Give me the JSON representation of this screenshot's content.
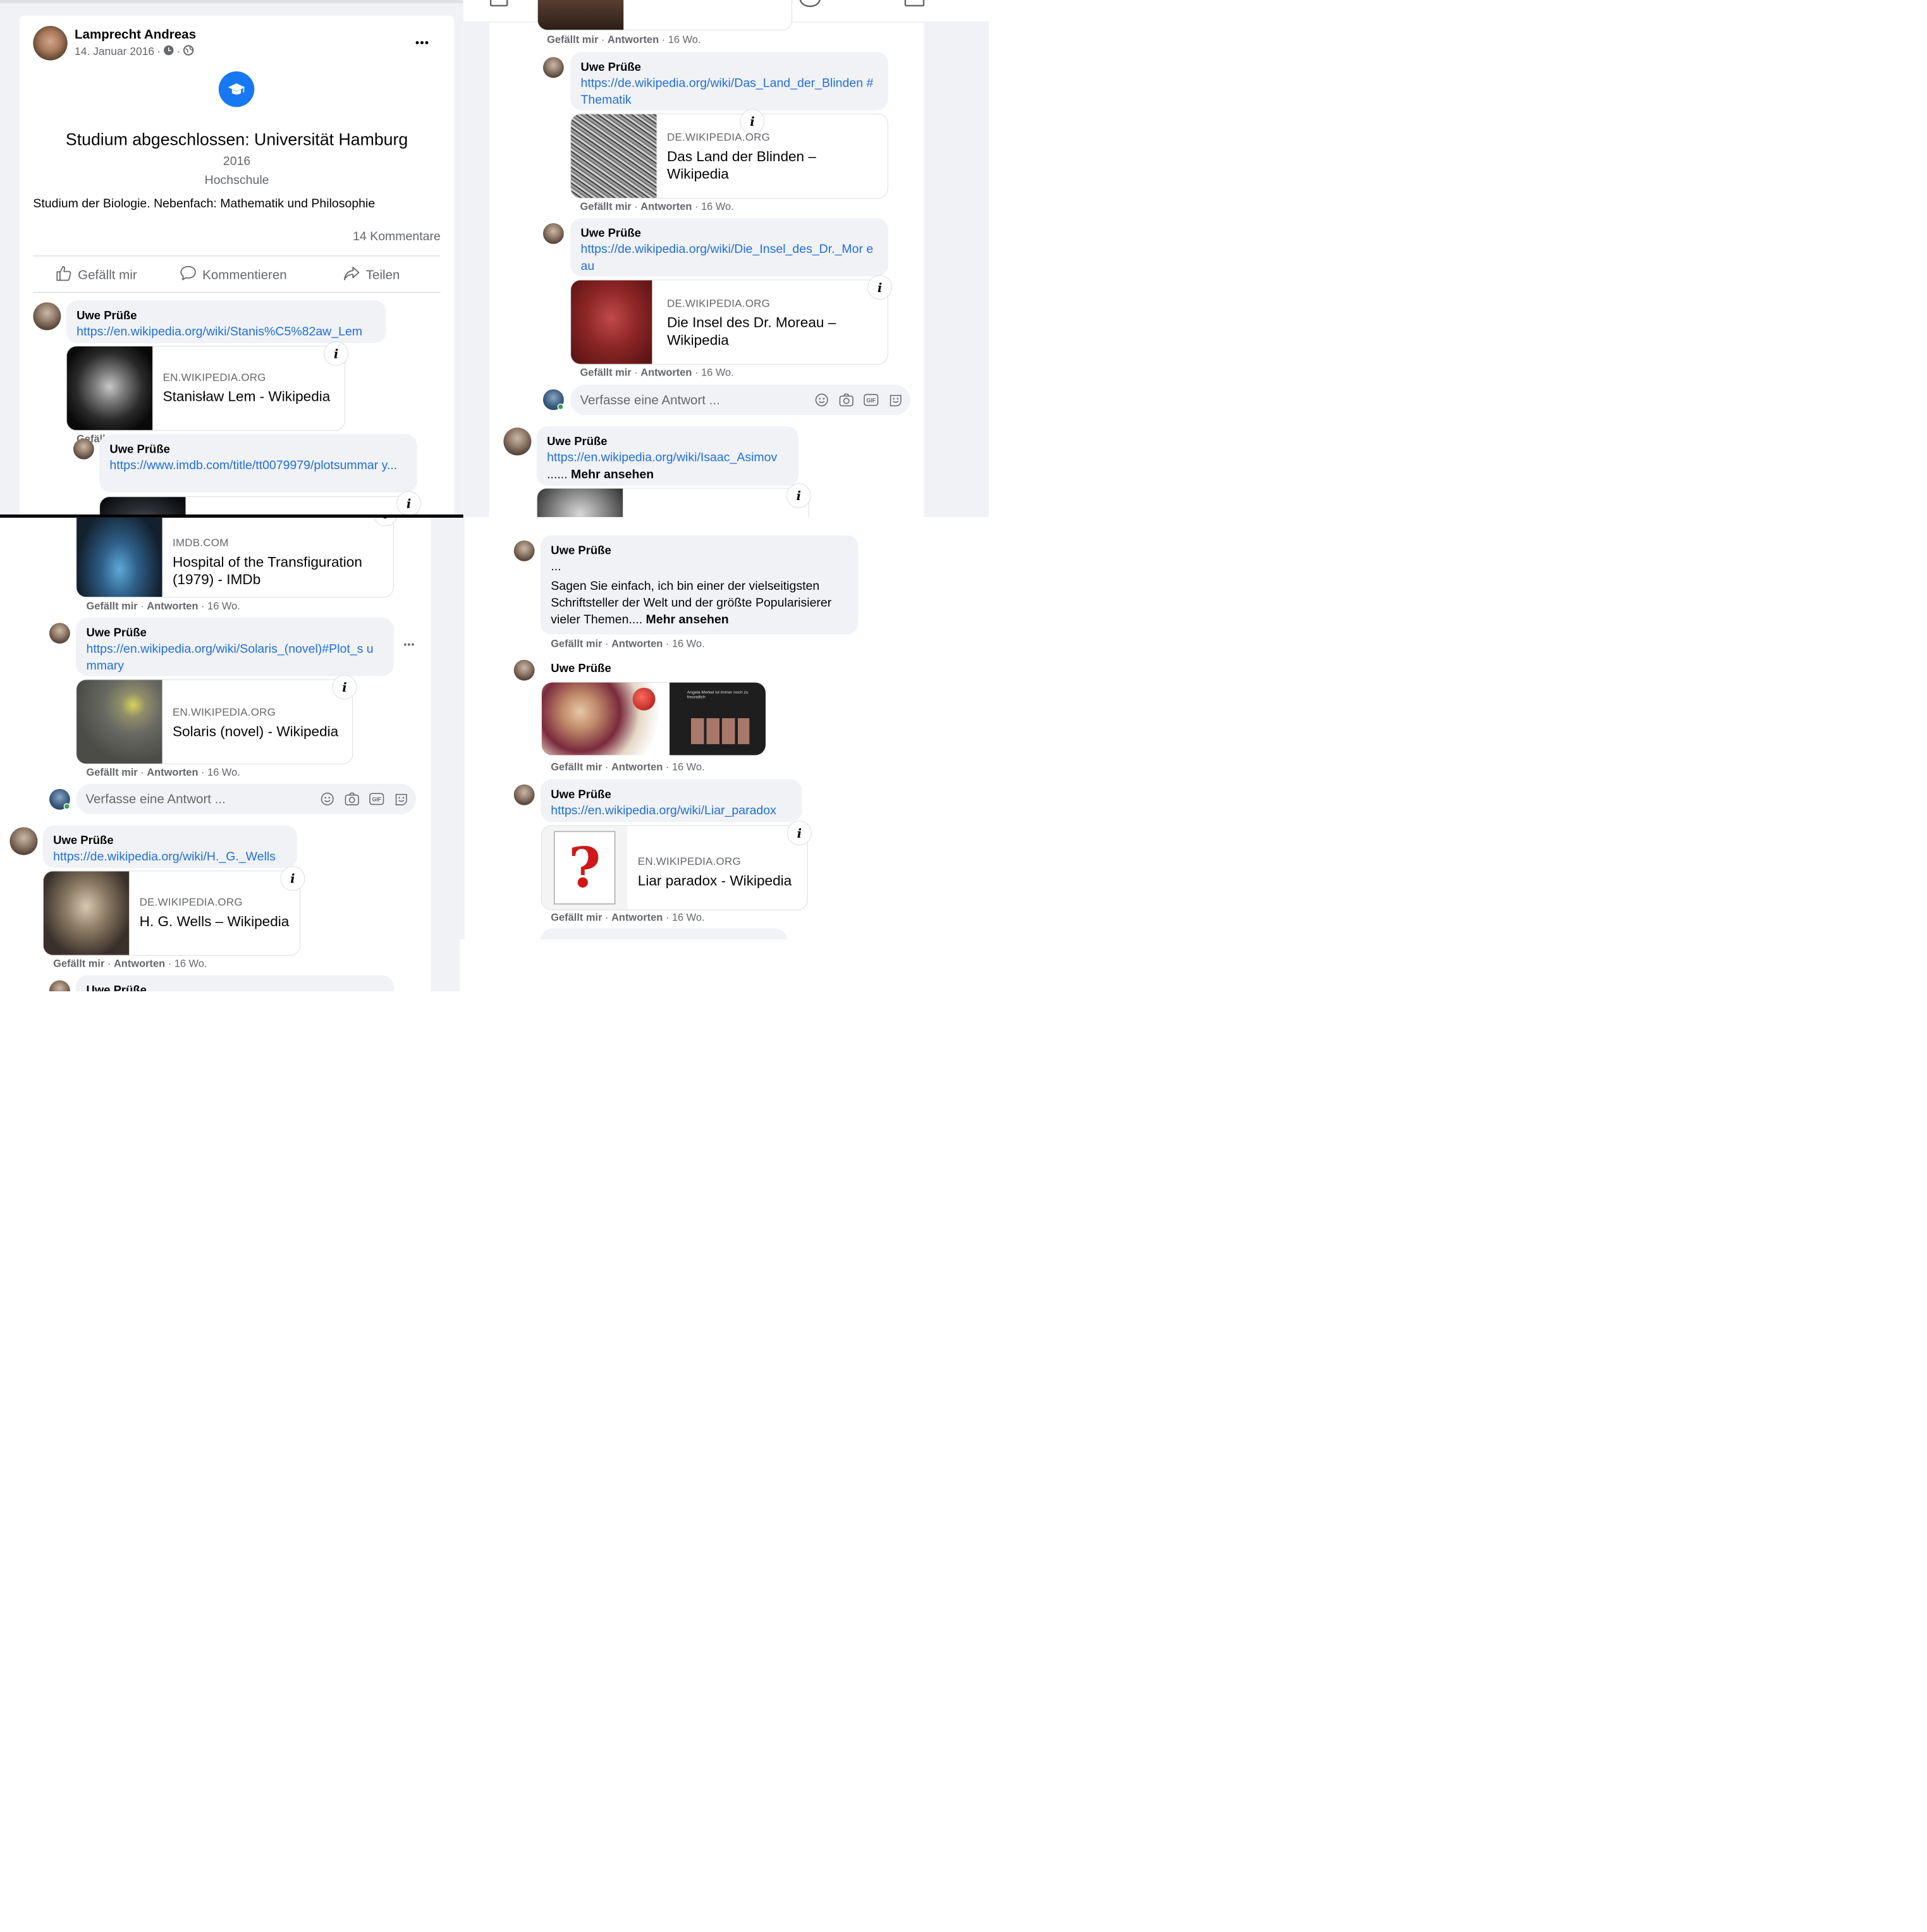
{
  "post": {
    "author": "Lamprecht Andreas",
    "date": "14. Januar 2016",
    "date_sep": "·",
    "title": "Studium abgeschlossen: Universität Hamburg",
    "year": "2016",
    "school_type": "Hochschule",
    "description": "Studium der Biologie. Nebenfach: Mathematik und Philosophie",
    "comment_count": "14 Kommentare",
    "actions": {
      "like": "Gefällt mir",
      "comment": "Kommentieren",
      "share": "Teilen"
    },
    "more": "•••"
  },
  "comment_meta": {
    "like": "Gefällt mir",
    "sep": "·",
    "reply": "Antworten",
    "age": "· 16 Wo."
  },
  "reply_placeholder": "Verfasse eine Antwort ...",
  "gif_label": "GIF",
  "panel1": {
    "comments": [
      {
        "name": "Uwe Prüße",
        "link": "https://en.wikipedia.org/wiki/Stanis%C5%82aw_Lem",
        "domain": "EN.WIKIPEDIA.ORG",
        "title": "Stanisław Lem - Wikipedia"
      },
      {
        "name": "Uwe Prüße",
        "link": "https://www.imdb.com/title/tt0079979/plotsummar y..."
      }
    ]
  },
  "panel2": {
    "comments": [
      {
        "name": "Uwe Prüße",
        "link": "https://de.wikipedia.org/wiki/Das_Land_der_Blinden #Thematik",
        "domain": "DE.WIKIPEDIA.ORG",
        "title": "Das Land der Blinden – Wikipedia"
      },
      {
        "name": "Uwe Prüße",
        "link": "https://de.wikipedia.org/wiki/Die_Insel_des_Dr._Mor eau",
        "domain": "DE.WIKIPEDIA.ORG",
        "title": "Die Insel des Dr. Moreau – Wikipedia"
      },
      {
        "name": "Uwe Prüße",
        "link": "https://en.wikipedia.org/wiki/Isaac_Asimov",
        "more_prefix": "......",
        "more": "Mehr ansehen"
      }
    ]
  },
  "panel3": {
    "comments": [
      {
        "domain": "IMDB.COM",
        "title": "Hospital of the Transfiguration (1979) - IMDb"
      },
      {
        "name": "Uwe Prüße",
        "link": "https://en.wikipedia.org/wiki/Solaris_(novel)#Plot_s ummary",
        "domain": "EN.WIKIPEDIA.ORG",
        "title": "Solaris (novel) - Wikipedia",
        "more": "•••"
      },
      {
        "name": "Uwe Prüße",
        "link": "https://de.wikipedia.org/wiki/H._G._Wells",
        "domain": "DE.WIKIPEDIA.ORG",
        "title": "H. G. Wells – Wikipedia"
      },
      {
        "name": "Uwe Prüße"
      }
    ]
  },
  "panel4": {
    "comments": [
      {
        "name": "Uwe Prüße",
        "ellipsis": "...",
        "text": "Sagen Sie einfach, ich bin einer der vielseitigsten Schriftsteller der Welt und der größte Popularisierer vieler Themen....",
        "more": "Mehr ansehen"
      },
      {
        "name": "Uwe Prüße",
        "image_caption": "Angela Merkel ist immer noch zu freundlich"
      },
      {
        "name": "Uwe Prüße",
        "link": "https://en.wikipedia.org/wiki/Liar_paradox",
        "domain": "EN.WIKIPEDIA.ORG",
        "title": "Liar paradox - Wikipedia"
      }
    ]
  },
  "colors": {
    "link": "#216fdb",
    "bubble": "#f0f2f5",
    "brand": "#1877f2",
    "meta": "#65676b",
    "online": "#31a24c"
  }
}
